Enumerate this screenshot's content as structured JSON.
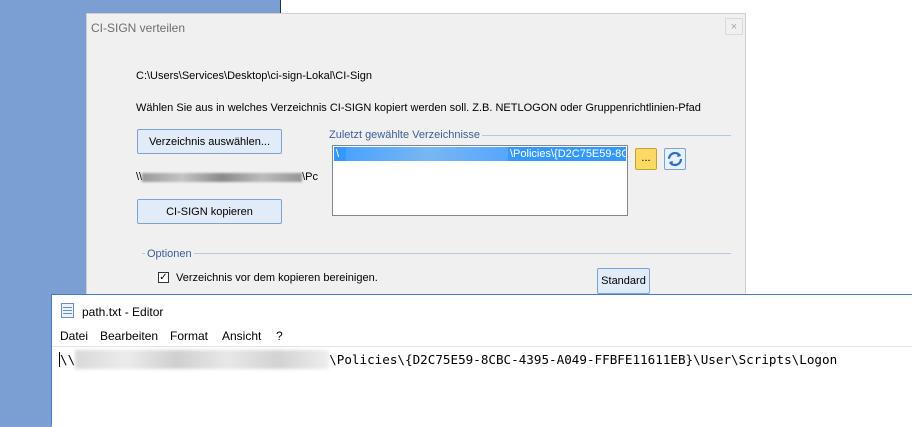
{
  "dialog": {
    "title": "CI-SIGN verteilen",
    "close_label": "×",
    "source_path": "C:\\Users\\Services\\Desktop\\ci-sign-Lokal\\CI-Sign",
    "instruction": "Wählen Sie aus in welches Verzeichnis CI-SIGN kopiert werden soll. Z.B. NETLOGON oder Gruppenrichtlinien-Pfad",
    "select_dir_button": "Verzeichnis auswählen...",
    "target_path_prefix": "\\\\",
    "target_path_suffix": "\\Pc",
    "copy_button": "CI-SIGN kopieren",
    "recent": {
      "group_title": "Zuletzt gewählte Verzeichnisse",
      "selected_prefix": "\\",
      "selected_suffix": "\\Policies\\{D2C75E59-8CB",
      "browse_label": "..."
    },
    "options": {
      "group_title": "Optionen",
      "clean_label": "Verzeichnis vor dem kopieren bereinigen.",
      "clean_checked": true,
      "standard_button": "Standard"
    }
  },
  "notepad": {
    "title": "path.txt - Editor",
    "menus": [
      "Datei",
      "Bearbeiten",
      "Format",
      "Ansicht",
      "?"
    ],
    "content_prefix": "\\\\",
    "content_suffix": "\\Policies\\{D2C75E59-8CBC-4395-A049-FFBFE11611EB}\\User\\Scripts\\Logon"
  },
  "icons": [
    "close-icon",
    "refresh-icon",
    "checkmark-icon",
    "notepad-icon"
  ],
  "colors": {
    "accent": "#3399ff",
    "browse_button": "#fcd864",
    "group_title": "#3b5e9a"
  }
}
